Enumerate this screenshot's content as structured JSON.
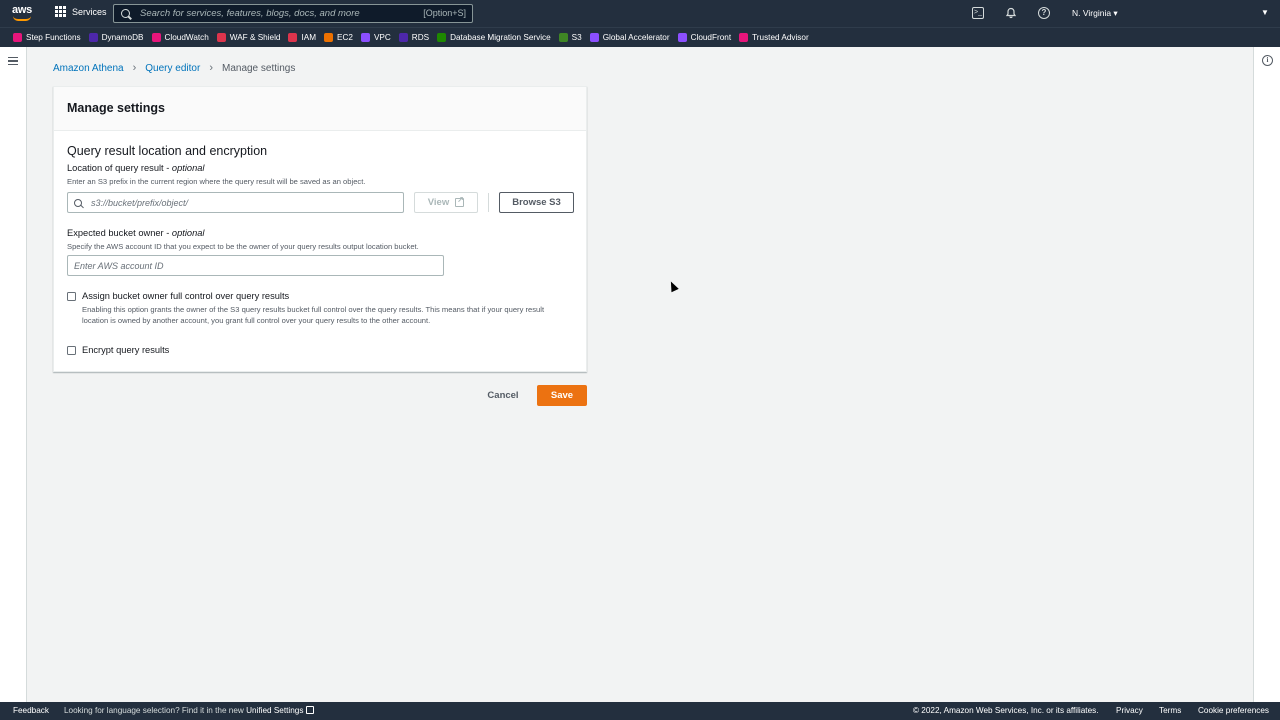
{
  "topnav": {
    "logo": "aws",
    "services_label": "Services",
    "search_placeholder": "Search for services, features, blogs, docs, and more",
    "search_shortcut": "[Option+S]",
    "region": "N. Virginia ▾",
    "icons": [
      "cloudshell-icon",
      "bell-icon",
      "help-icon"
    ]
  },
  "favorites": [
    {
      "label": "Step Functions",
      "color": "#e7157b"
    },
    {
      "label": "DynamoDB",
      "color": "#4d27aa"
    },
    {
      "label": "CloudWatch",
      "color": "#e7157b"
    },
    {
      "label": "WAF & Shield",
      "color": "#dd344c"
    },
    {
      "label": "IAM",
      "color": "#dd344c"
    },
    {
      "label": "EC2",
      "color": "#ed7100"
    },
    {
      "label": "VPC",
      "color": "#8c4fff"
    },
    {
      "label": "RDS",
      "color": "#4d27aa"
    },
    {
      "label": "Database Migration Service",
      "color": "#1e8900"
    },
    {
      "label": "S3",
      "color": "#3f8624"
    },
    {
      "label": "Global Accelerator",
      "color": "#8c4fff"
    },
    {
      "label": "CloudFront",
      "color": "#8c4fff"
    },
    {
      "label": "Trusted Advisor",
      "color": "#e7157b"
    }
  ],
  "breadcrumb": {
    "items": [
      "Amazon Athena",
      "Query editor"
    ],
    "current": "Manage settings"
  },
  "panel": {
    "title": "Manage settings",
    "section_title": "Query result location and encryption",
    "location": {
      "label": "Location of query result - ",
      "label_optional": "optional",
      "description": "Enter an S3 prefix in the current region where the query result will be saved as an object.",
      "placeholder": "s3://bucket/prefix/object/",
      "value": "",
      "view_label": "View",
      "browse_label": "Browse S3"
    },
    "owner": {
      "label": "Expected bucket owner - ",
      "label_optional": "optional",
      "description": "Specify the AWS account ID that you expect to be the owner of your query results output location bucket.",
      "placeholder": "Enter AWS account ID",
      "value": ""
    },
    "assign_control": {
      "label": "Assign bucket owner full control over query results",
      "description": "Enabling this option grants the owner of the S3 query results bucket full control over the query results. This means that if your query result location is owned by another account, you grant full control over your query results to the other account.",
      "checked": false
    },
    "encrypt": {
      "label": "Encrypt query results",
      "checked": false
    }
  },
  "actions": {
    "cancel_label": "Cancel",
    "save_label": "Save"
  },
  "footer": {
    "feedback": "Feedback",
    "lang_prefix": "Looking for language selection? Find it in the new ",
    "lang_link": "Unified Settings",
    "copyright": "© 2022, Amazon Web Services, Inc. or its affiliates.",
    "privacy": "Privacy",
    "terms": "Terms",
    "cookies": "Cookie preferences"
  },
  "colors": {
    "nav_bg": "#232f3e",
    "link": "#0073bb",
    "primary_button": "#ec7211"
  }
}
